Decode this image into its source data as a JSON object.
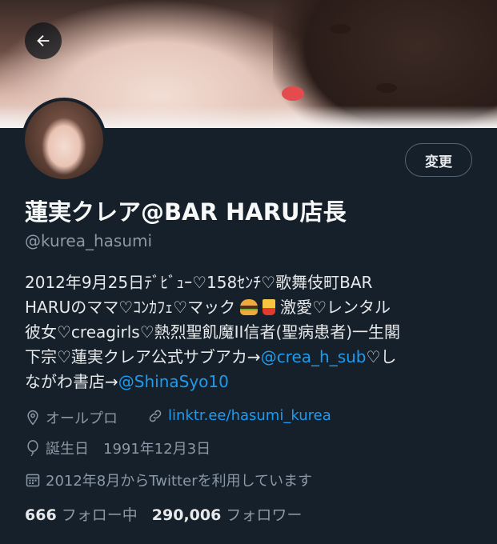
{
  "profile": {
    "edit_label": "変更",
    "display_name": "蓮実クレア@BAR HARU店長",
    "handle": "@kurea_hasumi",
    "bio": {
      "line1": "2012年9月25日ﾃﾞﾋﾞｭｰ♡158ｾﾝﾁ♡歌舞伎町BAR",
      "line2a": "HARUのママ♡ｺﾝｶﾌｪ♡マック",
      "line2b": "激愛♡レンタル",
      "line3": "彼女♡creagirls♡熱烈聖飢魔II信者(聖病患者)一生閣",
      "line4a": "下宗♡蓮実クレア公式サブアカ→",
      "mention1": "@crea_h_sub",
      "line4b": "♡し",
      "line5a": "ながわ書店→",
      "mention2": "@ShinaSyo10"
    },
    "location": "オールプロ",
    "website": "linktr.ee/hasumi_kurea",
    "birthday_label": "誕生日",
    "birthday": "1991年12月3日",
    "joined": "2012年8月からTwitterを利用しています",
    "following_count": "666",
    "following_label": "フォロー中",
    "followers_count": "290,006",
    "followers_label": "フォロワー"
  },
  "icons": {
    "back": "back-arrow-icon",
    "location": "location-pin-icon",
    "link": "link-icon",
    "birthday": "balloon-icon",
    "calendar": "calendar-icon"
  },
  "colors": {
    "background": "#15202b",
    "link": "#1d9bf0",
    "muted": "#8b98a5"
  }
}
